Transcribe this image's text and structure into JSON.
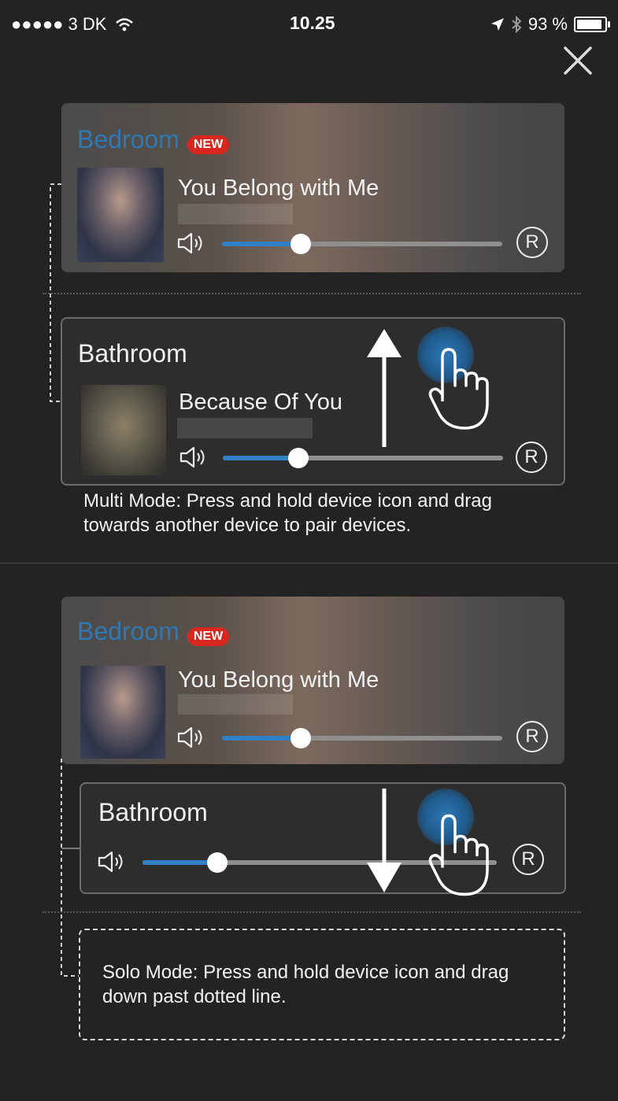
{
  "status_bar": {
    "carrier": "●●●●● 3 DK",
    "time": "10.25",
    "battery_text": "93 %",
    "battery_level": 0.93
  },
  "multi_mode": {
    "bedroom": {
      "name": "Bedroom",
      "badge": "NEW",
      "song": "You Belong with Me",
      "volume": 0.28,
      "button": "R"
    },
    "bathroom": {
      "name": "Bathroom",
      "song": "Because Of You",
      "volume": 0.27,
      "button": "R"
    },
    "instruction": "Multi Mode: Press and hold device icon and drag towards another device to pair devices."
  },
  "solo_mode": {
    "bedroom": {
      "name": "Bedroom",
      "badge": "NEW",
      "song": "You Belong with Me",
      "volume": 0.28,
      "button": "R"
    },
    "bathroom": {
      "name": "Bathroom",
      "volume": 0.21,
      "button": "R"
    },
    "instruction": "Solo Mode: Press and hold device icon and drag down past dotted line."
  },
  "colors": {
    "accent": "#2f80c4",
    "badge": "#d8271f",
    "background": "#232323"
  },
  "icons": [
    "location-arrow-icon",
    "bluetooth-icon",
    "battery-icon",
    "wifi-icon",
    "close-icon",
    "speaker-icon",
    "hand-pointer-icon"
  ]
}
